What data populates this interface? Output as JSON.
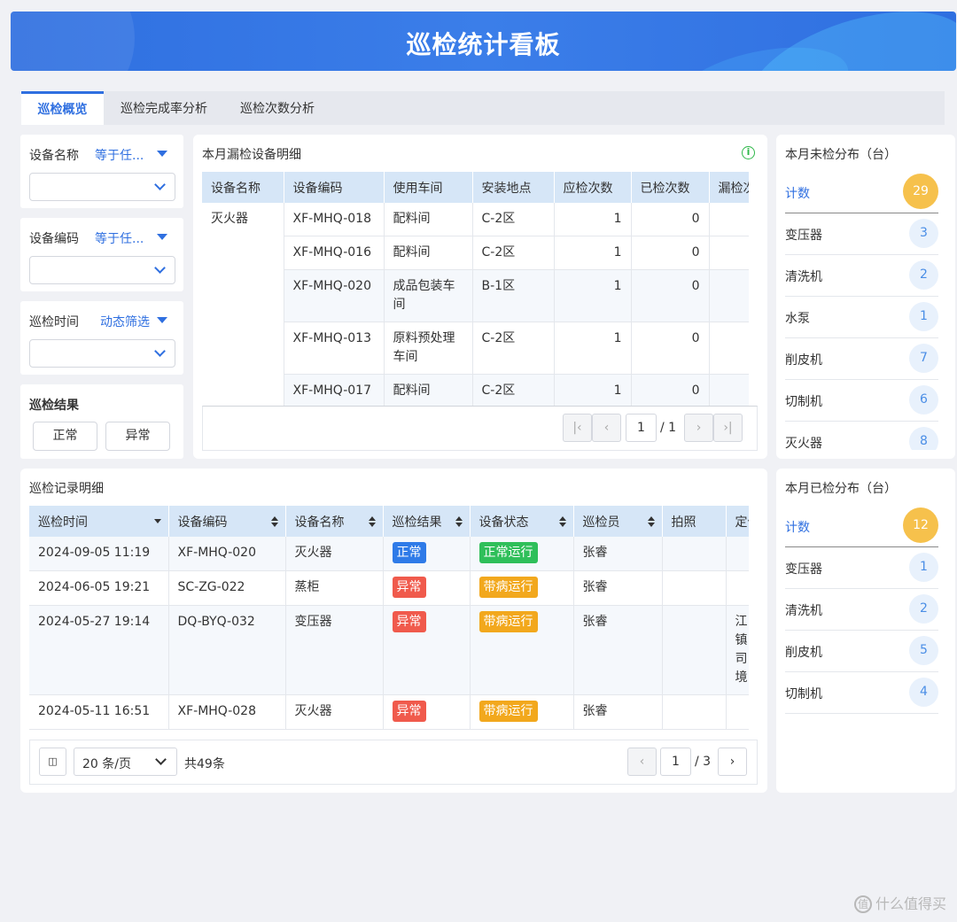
{
  "header": {
    "title": "巡检统计看板"
  },
  "tabs": [
    {
      "label": "巡检概览"
    },
    {
      "label": "巡检完成率分析"
    },
    {
      "label": "巡检次数分析"
    }
  ],
  "filters": {
    "device_name": {
      "label": "设备名称",
      "mode": "等于任..."
    },
    "device_code": {
      "label": "设备编码",
      "mode": "等于任..."
    },
    "inspect_time": {
      "label": "巡检时间",
      "mode": "动态筛选"
    },
    "result": {
      "label": "巡检结果",
      "options": [
        "正常",
        "异常"
      ]
    }
  },
  "missed": {
    "title": "本月漏检设备明细",
    "columns": [
      "设备名称",
      "设备编码",
      "使用车间",
      "安装地点",
      "应检次数",
      "已检次数",
      "漏检次数"
    ],
    "group_name": "灭火器",
    "rows": [
      {
        "code": "XF-MHQ-018",
        "workshop": "配料间",
        "location": "C-2区",
        "due": "1",
        "done": "0"
      },
      {
        "code": "XF-MHQ-016",
        "workshop": "配料间",
        "location": "C-2区",
        "due": "1",
        "done": "0"
      },
      {
        "code": "XF-MHQ-020",
        "workshop": "成品包装车间",
        "location": "B-1区",
        "due": "1",
        "done": "0"
      },
      {
        "code": "XF-MHQ-013",
        "workshop": "原料预处理车间",
        "location": "C-2区",
        "due": "1",
        "done": "0"
      },
      {
        "code": "XF-MHQ-017",
        "workshop": "配料间",
        "location": "C-2区",
        "due": "1",
        "done": "0"
      }
    ],
    "pager": {
      "page": "1",
      "total": "/ 1"
    }
  },
  "unchecked": {
    "title": "本月未检分布（台）",
    "head": {
      "label": "计数",
      "count": "29"
    },
    "items": [
      {
        "label": "变压器",
        "count": "3"
      },
      {
        "label": "清洗机",
        "count": "2"
      },
      {
        "label": "水泵",
        "count": "1"
      },
      {
        "label": "削皮机",
        "count": "7"
      },
      {
        "label": "切制机",
        "count": "6"
      },
      {
        "label": "灭火器",
        "count": "8"
      }
    ]
  },
  "checked": {
    "title": "本月已检分布（台）",
    "head": {
      "label": "计数",
      "count": "12"
    },
    "items": [
      {
        "label": "变压器",
        "count": "1"
      },
      {
        "label": "清洗机",
        "count": "2"
      },
      {
        "label": "削皮机",
        "count": "5"
      },
      {
        "label": "切制机",
        "count": "4"
      }
    ]
  },
  "records": {
    "title": "巡检记录明细",
    "columns": [
      "巡检时间",
      "设备编码",
      "设备名称",
      "巡检结果",
      "设备状态",
      "巡检员",
      "拍照",
      "定位"
    ],
    "rows": [
      {
        "time": "2024-09-05 11:19",
        "code": "XF-MHQ-020",
        "name": "灭火器",
        "result": "正常",
        "status": "正常运行",
        "inspector": "张睿",
        "loc": ""
      },
      {
        "time": "2024-06-05 19:21",
        "code": "SC-ZG-022",
        "name": "蒸柜",
        "result": "异常",
        "status": "带病运行",
        "inspector": "张睿",
        "loc": ""
      },
      {
        "time": "2024-05-27 19:14",
        "code": "DQ-BYQ-032",
        "name": "变压器",
        "result": "异常",
        "status": "带病运行",
        "inspector": "张睿",
        "loc": "江镇司境"
      },
      {
        "time": "2024-05-11 16:51",
        "code": "XF-MHQ-028",
        "name": "灭火器",
        "result": "异常",
        "status": "带病运行",
        "inspector": "张睿",
        "loc": ""
      }
    ],
    "page_size": "20 条/页",
    "total": "共49条",
    "pager": {
      "page": "1",
      "total": "/ 3"
    }
  },
  "watermark": {
    "text": "什么值得买",
    "logo": "值"
  }
}
